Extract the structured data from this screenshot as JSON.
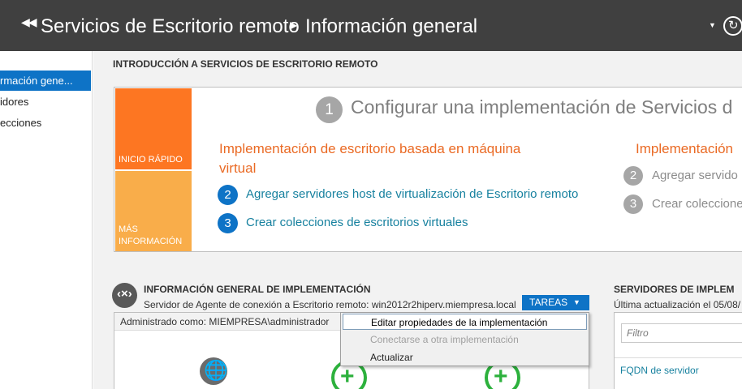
{
  "header": {
    "breadcrumb_part1": "Servicios de Escritorio remoto",
    "breadcrumb_part2": "Información general"
  },
  "sidebar": {
    "items": [
      {
        "label": "rmación gene..."
      },
      {
        "label": "idores"
      },
      {
        "label": "ecciones"
      }
    ]
  },
  "intro": {
    "title": "INTRODUCCIÓN A SERVICIOS DE ESCRITORIO REMOTO",
    "tile_quick": "INICIO RÁPIDO",
    "tile_more_line1": "MÁS",
    "tile_more_line2": "INFORMACIÓN",
    "step1_number": "1",
    "step1_title": "Configurar una implementación de Servicios d",
    "vm_heading_line1": "Implementación de escritorio basada en máquina",
    "vm_heading_line2": "virtual",
    "vm_steps": [
      {
        "number": "2",
        "label": "Agregar servidores host de virtualización de Escritorio remoto"
      },
      {
        "number": "3",
        "label": "Crear colecciones de escritorios virtuales"
      }
    ],
    "session_heading": "Implementación",
    "session_steps": [
      {
        "number": "2",
        "label": "Agregar servido"
      },
      {
        "number": "3",
        "label": "Crear coleccione"
      }
    ]
  },
  "deployment": {
    "title": "INFORMACIÓN GENERAL DE IMPLEMENTACIÓN",
    "subtitle": "Servidor de Agente de conexión a Escritorio remoto: win2012r2hiperv.miempresa.local",
    "tasks_label": "TAREAS",
    "admin_as": "Administrado como: MIEMPRESA\\administrador"
  },
  "tasks_menu": {
    "items": [
      {
        "label": "Editar propiedades de la implementación",
        "state": "highlighted"
      },
      {
        "label": "Conectarse a otra implementación",
        "state": "disabled"
      },
      {
        "label": "Actualizar",
        "state": "normal"
      }
    ]
  },
  "servers": {
    "title": "SERVIDORES DE IMPLEM",
    "last_update": "Última actualización el 05/08/",
    "filter_placeholder": "Filtro",
    "column_fqdn": "FQDN de servidor"
  },
  "colors": {
    "title_bar": "#404040",
    "accent_blue": "#0e73c6",
    "tile_orange": "#fd7622",
    "tile_yellow": "#f9ad4a",
    "link_blue": "#17819f",
    "heading_orange": "#ea6a24",
    "plus_green": "#2db13d"
  },
  "icons": [
    "back-arrows-icon",
    "breadcrumb-arrow-icon",
    "dropdown-arrow-icon",
    "refresh-icon",
    "deployment-icon",
    "globe-icon",
    "plus-icon",
    "tasks-dropdown-icon"
  ]
}
